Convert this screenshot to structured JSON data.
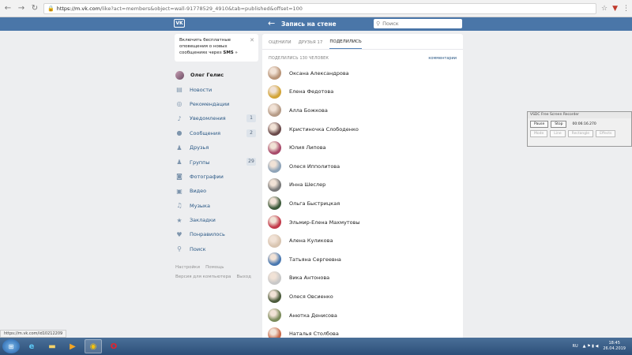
{
  "browser": {
    "url_host": "https://m.vk.com",
    "url_path": "/like?act=members&object=wall-91778529_4910&tab=published&offset=100"
  },
  "header": {
    "logo": "VK",
    "title": "Запись на стене",
    "search_placeholder": "Поиск"
  },
  "notification": {
    "text_pre": "Включить бесплатные оповещения о новых сообщениях через ",
    "text_bold": "SMS",
    "text_post": " »"
  },
  "sidebar": {
    "user": "Олег Гелис",
    "items": [
      {
        "label": "Новости",
        "icon": "news-icon",
        "badge": ""
      },
      {
        "label": "Рекомендации",
        "icon": "compass-icon",
        "badge": ""
      },
      {
        "label": "Уведомления",
        "icon": "bell-icon",
        "badge": "1"
      },
      {
        "label": "Сообщения",
        "icon": "message-icon",
        "badge": "2"
      },
      {
        "label": "Друзья",
        "icon": "user-icon",
        "badge": ""
      },
      {
        "label": "Группы",
        "icon": "group-icon",
        "badge": "29"
      },
      {
        "label": "Фотографии",
        "icon": "camera-icon",
        "badge": ""
      },
      {
        "label": "Видео",
        "icon": "video-icon",
        "badge": ""
      },
      {
        "label": "Музыка",
        "icon": "music-icon",
        "badge": ""
      },
      {
        "label": "Закладки",
        "icon": "star-icon",
        "badge": ""
      },
      {
        "label": "Понравилось",
        "icon": "heart-icon",
        "badge": ""
      },
      {
        "label": "Поиск",
        "icon": "search-icon",
        "badge": ""
      }
    ],
    "footer": {
      "settings": "Настройки",
      "help": "Помощь",
      "desktop": "Версия для компьютера",
      "logout": "Выход"
    }
  },
  "main": {
    "tabs": {
      "rated": "ОЦЕНИЛИ",
      "friends": "ДРУЗЬЯ 17",
      "shared": "ПОДЕЛИЛИСЬ"
    },
    "count_label": "ПОДЕЛИЛИСЬ 130 ЧЕЛОВЕК",
    "comments_link": "комментарии",
    "people": [
      {
        "name": "Оксана Александрова",
        "color": "#b89478"
      },
      {
        "name": "Елена Федотова",
        "color": "#d2a437"
      },
      {
        "name": "Алла Божкова",
        "color": "#b59a86"
      },
      {
        "name": "Кристиночка Слободенко",
        "color": "#6a4a4a"
      },
      {
        "name": "Юлия Липова",
        "color": "#a84a6a"
      },
      {
        "name": "Олеся Ипполитова",
        "color": "#8ea3b8"
      },
      {
        "name": "Инна Шеслер",
        "color": "#787878"
      },
      {
        "name": "Ольга Быстрицкая",
        "color": "#3d5a3a"
      },
      {
        "name": "Эльмир-Елена Махмутовы",
        "color": "#c23a4a"
      },
      {
        "name": "Алена Куликова",
        "color": "#d8c4b0"
      },
      {
        "name": "Татьяна Сергеевна",
        "color": "#4a78b0"
      },
      {
        "name": "Вика Антонова",
        "color": "#c8c8c8"
      },
      {
        "name": "Олеся Овсиенко",
        "color": "#4a5a3a"
      },
      {
        "name": "Анютка Денисова",
        "color": "#7a8a5a"
      },
      {
        "name": "Наталья Столбова",
        "color": "#c86a4a"
      }
    ]
  },
  "recorder": {
    "title": "VSDC Free Screen Recorder",
    "pause": "Pause",
    "stop": "Stop",
    "time": "00:06:16.270",
    "mode1": "Mode",
    "mode2": "Line",
    "mode3": "Rectangle",
    "mode4": "Effects"
  },
  "status_url": "https://m.vk.com/id10212209",
  "taskbar": {
    "lang": "RU",
    "time": "18:45",
    "date": "26.04.2019"
  }
}
